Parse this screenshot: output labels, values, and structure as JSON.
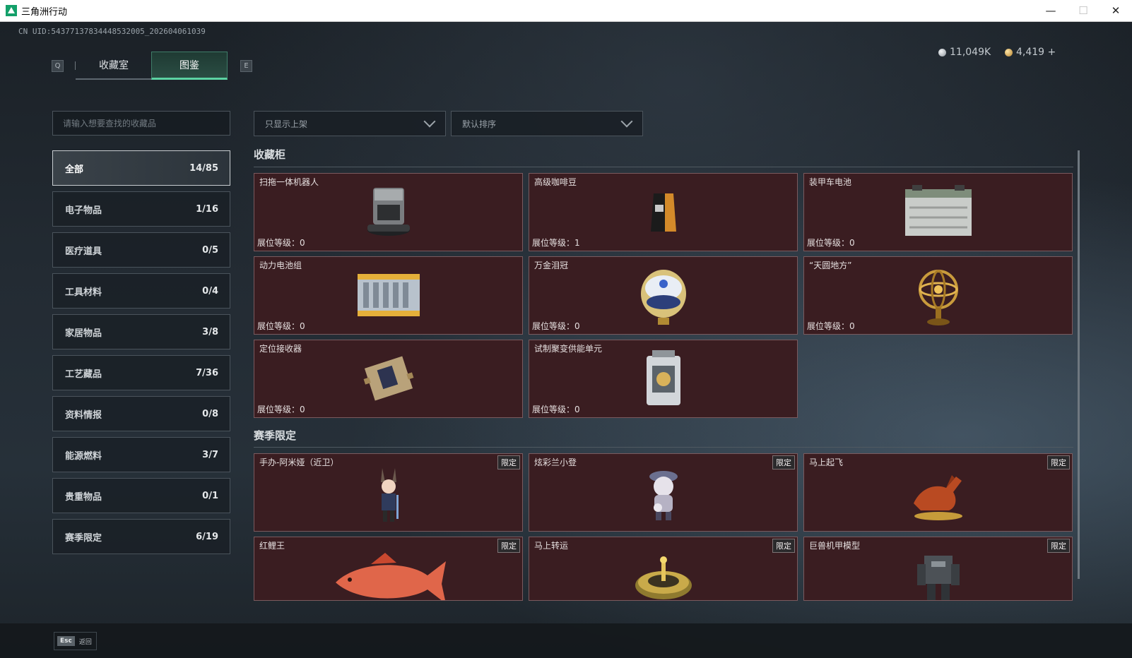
{
  "window": {
    "title": "三角洲行动",
    "minimize": "—",
    "maximize": "☐",
    "close": "✕"
  },
  "header": {
    "uid": "CN UID:543771378344485320​05_202604061039",
    "silver_amount": "11,049K",
    "gold_amount": "4,419 +"
  },
  "tabs": {
    "prev_key": "Q",
    "next_key": "E",
    "items": [
      {
        "label": "收藏室"
      },
      {
        "label": "图鉴"
      }
    ],
    "active": "图鉴"
  },
  "search": {
    "placeholder": "请输入想要查找的收藏品"
  },
  "filters": {
    "shelf": "只显示上架",
    "sort": "默认排序"
  },
  "categories": [
    {
      "label": "全部",
      "count": "14/85"
    },
    {
      "label": "电子物品",
      "count": "1/16"
    },
    {
      "label": "医疗道具",
      "count": "0/5"
    },
    {
      "label": "工具材料",
      "count": "0/4"
    },
    {
      "label": "家居物品",
      "count": "3/8"
    },
    {
      "label": "工艺藏品",
      "count": "7/36"
    },
    {
      "label": "资料情报",
      "count": "0/8"
    },
    {
      "label": "能源燃料",
      "count": "3/7"
    },
    {
      "label": "贵重物品",
      "count": "0/1"
    },
    {
      "label": "赛季限定",
      "count": "6/19"
    }
  ],
  "sections": {
    "cabinet": {
      "title": "收藏柜",
      "level_label": "展位等级：",
      "items": [
        {
          "name": "扫拖一体机器人",
          "level": "0",
          "icon": "robot-vacuum-icon"
        },
        {
          "name": "高级咖啡豆",
          "level": "1",
          "icon": "coffee-bag-icon"
        },
        {
          "name": "装甲车电池",
          "level": "0",
          "icon": "car-battery-icon"
        },
        {
          "name": "动力电池组",
          "level": "0",
          "icon": "battery-pack-icon"
        },
        {
          "name": "万金泪冠",
          "level": "0",
          "icon": "jeweled-egg-icon"
        },
        {
          "name": "“天圆地方”",
          "level": "0",
          "icon": "armillary-sphere-icon"
        },
        {
          "name": "定位接收器",
          "level": "0",
          "icon": "gps-receiver-icon"
        },
        {
          "name": "试制聚变供能单元",
          "level": "0",
          "icon": "fusion-cell-icon"
        }
      ]
    },
    "season": {
      "title": "赛季限定",
      "limit_label": "限定",
      "items": [
        {
          "name": "手办-阿米娅（近卫）",
          "icon": "figure-icon"
        },
        {
          "name": "炫彩兰小登",
          "icon": "mascot-icon"
        },
        {
          "name": "马上起飞",
          "icon": "horse-statue-icon"
        },
        {
          "name": "红鲤王",
          "icon": "carp-icon"
        },
        {
          "name": "马上转运",
          "icon": "roulette-icon"
        },
        {
          "name": "巨兽机甲模型",
          "icon": "mecha-model-icon"
        }
      ]
    }
  },
  "footer": {
    "esc_key": "Esc",
    "back_label": "返回"
  }
}
